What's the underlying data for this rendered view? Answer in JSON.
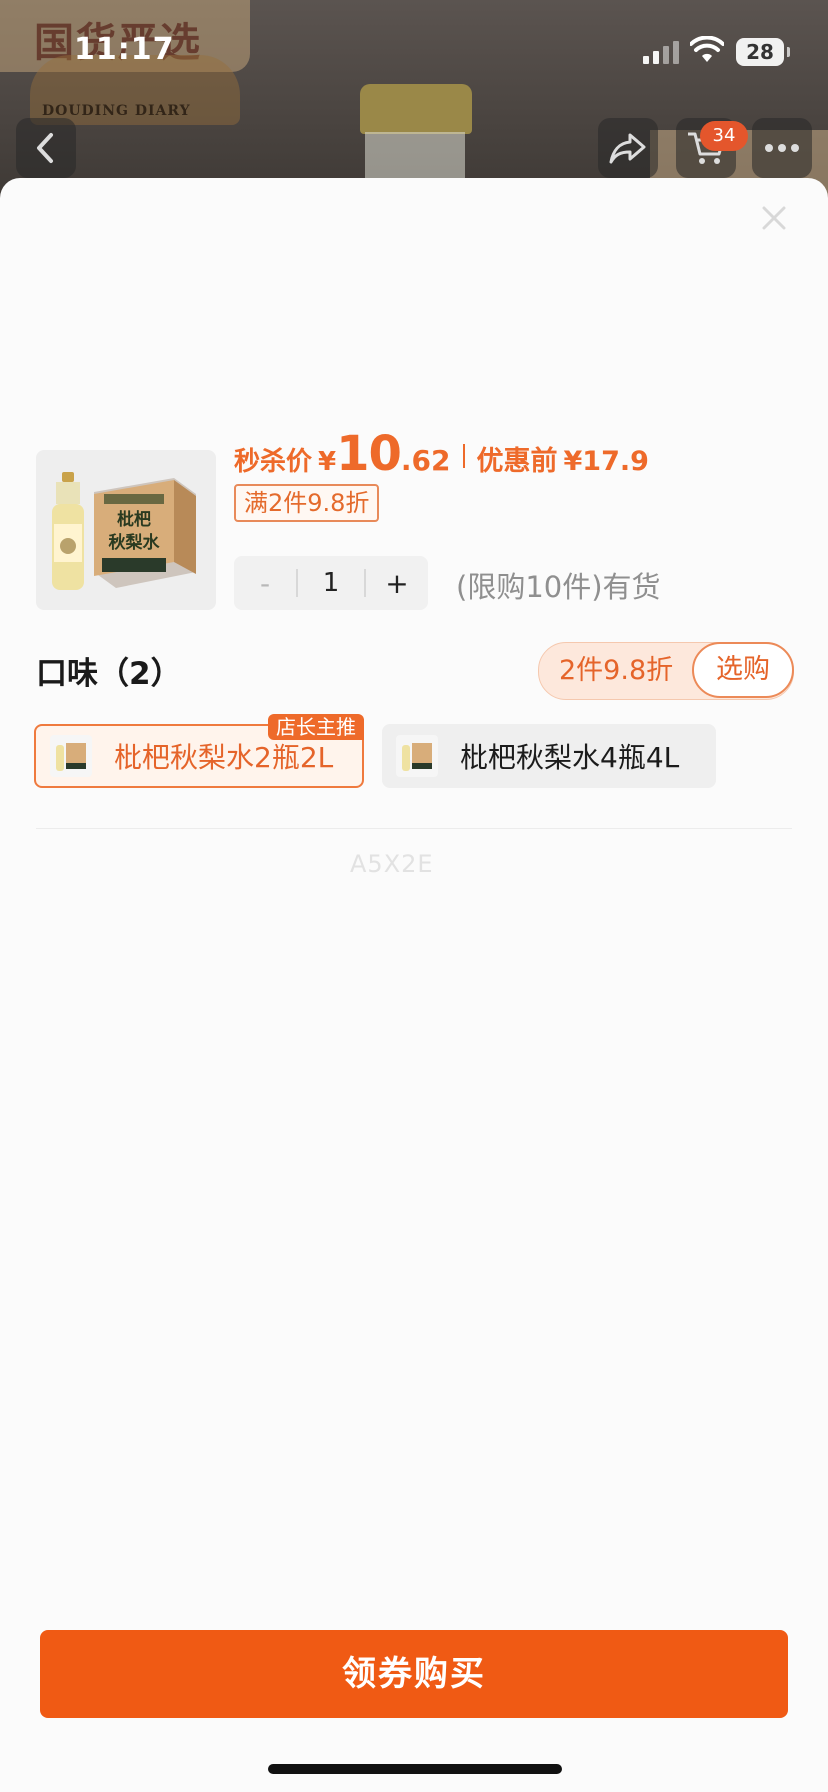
{
  "status_bar": {
    "time": "11:17",
    "battery": "28"
  },
  "background": {
    "brand": "国货严选",
    "brand_tagline": "DOUDING DIARY",
    "cart_count": "34"
  },
  "product": {
    "price_label": "秒杀价",
    "currency": "¥",
    "price_int": "10",
    "price_dec": ".62",
    "original_price_label": "优惠前",
    "original_price": "¥17.9",
    "discount_tag": "满2件9.8折",
    "quantity": "1",
    "stepper_minus": "-",
    "stepper_plus": "+",
    "stock_text": "(限购10件)有货",
    "thumb_box_text": "枇杷秋梨水"
  },
  "flavor": {
    "title": "口味（2）",
    "promo": "2件9.8折",
    "promo_action": "选购",
    "options": [
      {
        "label": "枇杷秋梨水2瓶2L",
        "badge": "店长主推",
        "selected": true
      },
      {
        "label": "枇杷秋梨水4瓶4L",
        "selected": false
      }
    ]
  },
  "watermark": "A5X2E",
  "buy_button": "领券购买",
  "colors": {
    "accent": "#f05a14",
    "price": "#ee6a2a"
  }
}
